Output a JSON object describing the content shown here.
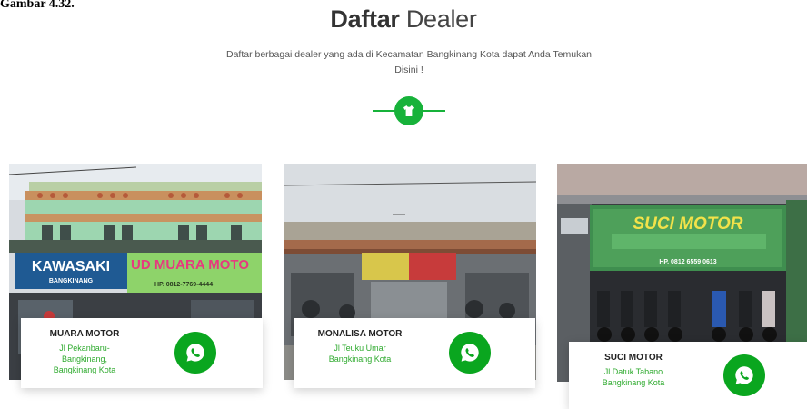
{
  "caption": "Gambar 4.32.",
  "header": {
    "title_bold": "Daftar",
    "title_light": "Dealer",
    "subtitle": "Daftar berbagai dealer yang ada di Kecamatan Bangkinang Kota dapat Anda Temukan Disini !"
  },
  "icons": {
    "divider": "tshirt-icon",
    "contact": "whatsapp-icon"
  },
  "colors": {
    "accent": "#17b23a",
    "whatsapp": "#0aa61f",
    "address_text": "#2eaa2e"
  },
  "dealers": [
    {
      "name": "MUARA MOTOR",
      "address": [
        "Jl Pekanbaru-",
        "Bangkinang,",
        "Bangkinang Kota"
      ],
      "signs": [
        "KAWASAKI",
        "BANGKINANG",
        "UD MUARA MOTO",
        "HP. 0812-7769-4444"
      ]
    },
    {
      "name": "MONALISA MOTOR",
      "address": [
        "Jl Teuku Umar",
        "Bangkinang Kota"
      ],
      "signs": []
    },
    {
      "name": "SUCI MOTOR",
      "address": [
        "Jl Datuk Tabano",
        "Bangkinang Kota"
      ],
      "signs": [
        "SUCI MOTOR",
        "HP. 0812 6559 0613"
      ]
    }
  ]
}
